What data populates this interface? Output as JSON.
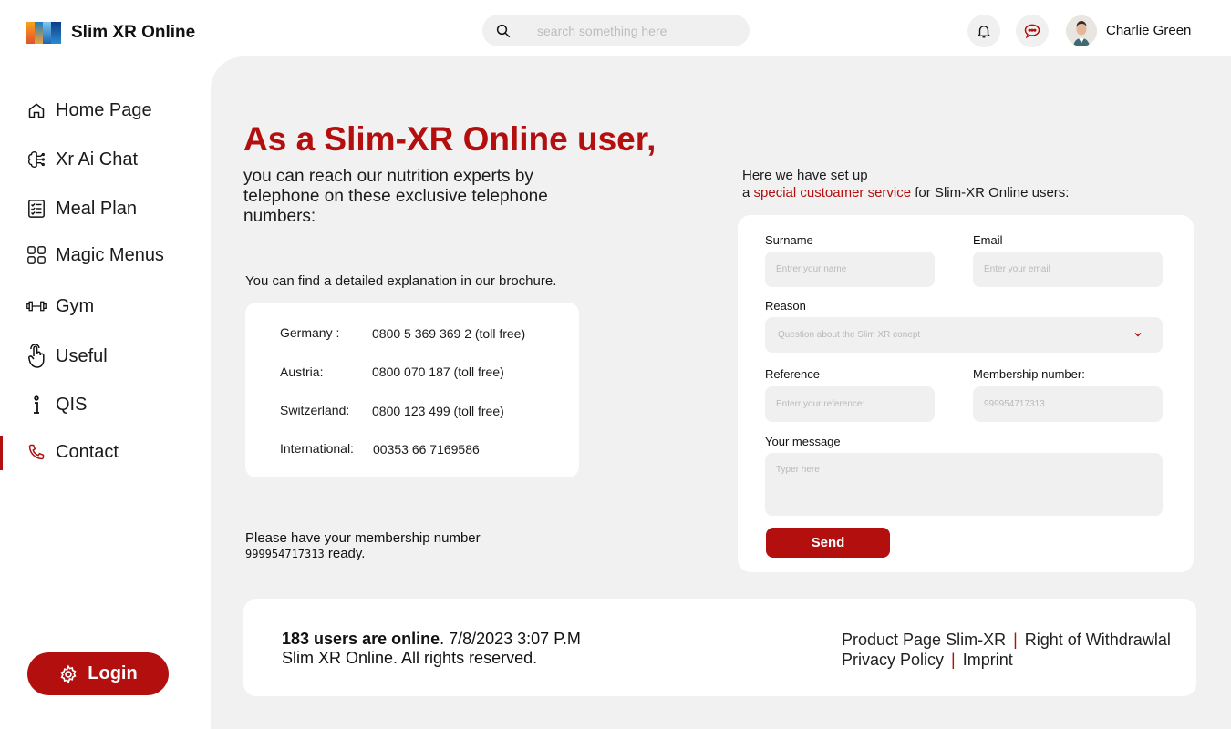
{
  "app": {
    "title": "Slim XR Online"
  },
  "search": {
    "placeholder": "search something here"
  },
  "user": {
    "name": "Charlie Green"
  },
  "sidebar": {
    "items": [
      {
        "label": "Home Page",
        "icon": "home-icon"
      },
      {
        "label": "Xr Ai Chat",
        "icon": "brain-icon"
      },
      {
        "label": "Meal Plan",
        "icon": "checklist-icon"
      },
      {
        "label": "Magic Menus",
        "icon": "grid-icon"
      },
      {
        "label": "Gym",
        "icon": "dumbbell-icon"
      },
      {
        "label": "Useful",
        "icon": "hand-pointer-icon"
      },
      {
        "label": "QIS",
        "icon": "info-icon"
      },
      {
        "label": "Contact",
        "icon": "phone-icon"
      }
    ],
    "active": "Contact",
    "login_label": "Login"
  },
  "main": {
    "headline": "As a Slim-XR Online user,",
    "subline": "you can reach our nutrition experts by telephone on these exclusive telephone numbers:",
    "brochure": "You can find a detailed explanation in our brochure.",
    "phones": [
      {
        "country": "Germany :",
        "number": "0800 5 369 369 2 (toll free)"
      },
      {
        "country": "Austria:",
        "number": "0800 070 187 (toll free)"
      },
      {
        "country": "Switzerland:",
        "number": "0800 123 499 (toll free)"
      },
      {
        "country": "International:",
        "number": "00353 66 7169586"
      }
    ],
    "membership_note_1": "Please have your membership number",
    "membership_number": "999954717313",
    "membership_note_2": " ready."
  },
  "service": {
    "line1": "Here we have set up",
    "prefix": "a ",
    "highlight": "special custoamer service",
    "suffix": " for Slim-XR Online users:"
  },
  "form": {
    "surname_label": "Surname",
    "surname_placeholder": "Entrer your name",
    "email_label": "Email",
    "email_placeholder": "Enter your email",
    "reason_label": "Reason",
    "reason_value": "Question about the Slim XR conept",
    "reference_label": "Reference",
    "reference_placeholder": "Enterr your reference:",
    "membership_label": "Membership number:",
    "membership_placeholder": "999954717313",
    "message_label": "Your message",
    "message_placeholder": "Typer here",
    "send_label": "Send"
  },
  "footer": {
    "online": "183 users are online",
    "datetime": ". 7/8/2023 3:07 P.M",
    "rights": "Slim XR Online. All rights reserved.",
    "links": [
      "Product Page Slim-XR",
      "Right of Withdrawlal",
      "Privacy Policy",
      "Imprint"
    ]
  },
  "colors": {
    "accent": "#b30f0f",
    "panel": "#f1f1f1",
    "input": "#f0f0f0"
  }
}
